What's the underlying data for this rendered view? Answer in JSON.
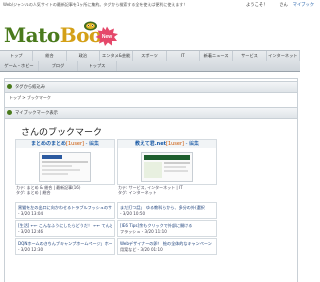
{
  "topbar": {
    "tagline": "Web/ジャンルの人気サイトの最新記事を1ヶ所に集約。タグから検索する全を使えば便利に使えます！",
    "welcome": "ようこそ！",
    "user": "さん",
    "mypage": "マイブック"
  },
  "logo": {
    "part1": "Mato",
    "part2": "Boo",
    "badge": "New"
  },
  "nav": {
    "row1": [
      "トップ",
      "総合",
      "政治",
      "エンタメ&芸能",
      "スポーツ",
      "IT",
      "新着ニュース",
      "サービス",
      "インターネット"
    ],
    "row2": [
      "ゲーム・ホビー",
      "ブログ",
      "トップス"
    ]
  },
  "sections": {
    "tag_search": "タグから絞込み",
    "bookmark_display": "マイブックマーク表示"
  },
  "breadcrumb": "トップ > ブックマーク",
  "page_title": "さんのブックマーク",
  "cards": [
    {
      "title": "まとめのまとめ",
      "user_label": "[1user]",
      "edit": " - 編集",
      "meta1": "カテ: まとめ & 総合 | 最新記事(16)",
      "meta2": "タグ: まとめ | 総合"
    },
    {
      "title": "教えて君.net",
      "user_label": "[1user]",
      "edit": " - 編集",
      "meta1": "カテ: サービス, インターネット | IT",
      "meta2": "タグ: インターネット"
    }
  ],
  "left_items": [
    {
      "l1": "黒猫を左の出口に向かわせるトラブルフッシュのサイト",
      "l2": "- 3/20 13:04"
    },
    {
      "l1": "[生活] ←← こんなふうにしたらどうだ！ ←← てんどん",
      "l2": "- 3/20 12:46"
    },
    {
      "l1": "DQNホームのきちんブキャンプホームページ」ホームV I P P E R仲",
      "l2": "- 3/20 12:30"
    }
  ],
  "right_items": [
    {
      "l1": "まだ打つ話」 ゆる教科らから、多分の外(選択",
      "l2": "- 3/20 10:50"
    },
    {
      "l1": "[IE6 Tips]余もクリックで外部に開ける",
      "l2": "フラッシュ - 3/20 11:10"
    },
    {
      "l1": "Webデザイナーの卵！ 絵の全体的なキャンペーン",
      "l2": "用案など - 3/20 01:10"
    }
  ]
}
